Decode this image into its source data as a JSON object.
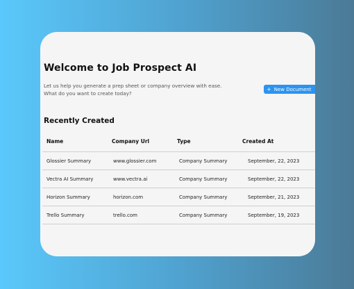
{
  "header": {
    "title": "Welcome to Job Prospect AI",
    "subtitle_line1": "Let us help you generate a prep sheet or company overview with ease.",
    "subtitle_line2": "What do you want to create today?"
  },
  "actions": {
    "new_document_icon": "+",
    "new_document_label": "New Document"
  },
  "recent": {
    "title": "Recently Created",
    "columns": [
      "Name",
      "Company Url",
      "Type",
      "Created At"
    ],
    "rows": [
      [
        "Glossier Summary",
        "www.glossier.com",
        "Company Summary",
        "September, 22, 2023"
      ],
      [
        "Vectra AI Summary",
        "www.vectra.ai",
        "Company Summary",
        "September, 22, 2023"
      ],
      [
        "Horizon Summary",
        "horizon.com",
        "Company Summary",
        "September, 21, 2023"
      ],
      [
        "Trello Summary",
        "trello.com",
        "Company Summary",
        "September, 19, 2023"
      ]
    ]
  },
  "colors": {
    "accent": "#2c93f0",
    "card_background": "#f5f5f5",
    "background_gradient_start": "#5ac8fb",
    "background_gradient_end": "#4b7a96"
  }
}
